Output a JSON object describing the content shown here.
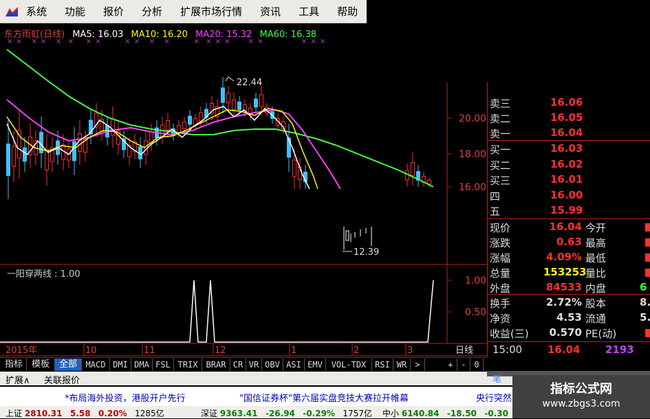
{
  "menu": [
    "系统",
    "功能",
    "报价",
    "分析",
    "扩展市场行情",
    "资讯",
    "工具",
    "帮助"
  ],
  "header": {
    "stock": "东方雨虹(日线)",
    "ma5": "MA5: 16.03",
    "ma10": "MA10: 16.20",
    "ma20": "MA20: 15.32",
    "ma60": "MA60: 16.38",
    "colors": {
      "ma5": "#ffffff",
      "ma10": "#ffff00",
      "ma20": "#ff40ff",
      "ma60": "#40ff40"
    }
  },
  "chart_data": {
    "type": "candlestick",
    "price_ticks": [
      "20.00",
      "18.00",
      "16.00"
    ],
    "high_label": "22.44",
    "low_label": "12.39",
    "indicator_ticks": [
      "1.00",
      "0.50"
    ],
    "date_labels": [
      "2015年",
      "10",
      "11",
      "12",
      "1",
      "2",
      "3"
    ],
    "period_label": "日线"
  },
  "indicator": {
    "label": "一阳穿两线 : 1.00"
  },
  "tabs": [
    "指标",
    "模板",
    "全部",
    "MACD",
    "DMI",
    "DMA",
    "FSL",
    "TRIX",
    "BRAR",
    "CR",
    "VR",
    "OBV",
    "ASI",
    "EMV",
    "VOL-TDX",
    "RSI",
    "WR",
    ">",
    "+",
    "-",
    "0"
  ],
  "extra": [
    "扩展∧",
    "关联报价"
  ],
  "quotes": {
    "asks": [
      {
        "label": "卖三",
        "val": "16.06"
      },
      {
        "label": "卖二",
        "val": "16.05"
      },
      {
        "label": "卖一",
        "val": "16.04"
      }
    ],
    "bids": [
      {
        "label": "买一",
        "val": "16.03"
      },
      {
        "label": "买二",
        "val": "16.02"
      },
      {
        "label": "买三",
        "val": "16.01"
      },
      {
        "label": "四",
        "val": "16.00"
      },
      {
        "label": "五",
        "val": "15.99"
      }
    ],
    "stats": [
      {
        "l1": "现价",
        "v1": "16.04",
        "c1": "#ff3030",
        "l2": "今开"
      },
      {
        "l1": "涨跌",
        "v1": "0.63",
        "c1": "#ff3030",
        "l2": "最高"
      },
      {
        "l1": "涨幅",
        "v1": "4.09%",
        "c1": "#ff3030",
        "l2": "最低"
      },
      {
        "l1": "总量",
        "v1": "153253",
        "c1": "#ffff00",
        "l2": "量比"
      },
      {
        "l1": "外盘",
        "v1": "84533",
        "c1": "#ff3030",
        "l2": "内盘",
        "v2": "6"
      },
      {
        "l1": "换手",
        "v1": "2.72%",
        "c1": "#dddddd",
        "l2": "股本",
        "v2": "8."
      },
      {
        "l1": "净资",
        "v1": "4.53",
        "c1": "#dddddd",
        "l2": "流通",
        "v2": "5."
      },
      {
        "l1": "收益(三)",
        "v1": "0.570",
        "c1": "#dddddd",
        "l2": "PE(动)"
      }
    ],
    "time": "15:00",
    "last": "16.04",
    "vol": "2193",
    "bottom_tab": "笔"
  },
  "news": [
    {
      "text": "*布局海外投资，港股开户先行",
      "color": "#0000c0"
    },
    {
      "text": "\"国信证券杯\"第六届实盘竞技大赛拉开帷幕",
      "color": "#0000c0"
    },
    {
      "text": "央行突然",
      "color": "#0000c0"
    }
  ],
  "indices": [
    {
      "name": "上证",
      "val": "2810.31",
      "chg": "5.58",
      "pct": "0.20%",
      "amt": "1285亿"
    },
    {
      "name": "深证",
      "val": "9363.41",
      "chg": "-26.94",
      "pct": "-0.29%",
      "amt": "1757亿"
    },
    {
      "name": "中小",
      "val": "6140.84",
      "chg": "-18.50",
      "pct": "-0.30"
    }
  ],
  "watermark": {
    "title": "指标公式网",
    "url": "www.zbgs3.com"
  }
}
